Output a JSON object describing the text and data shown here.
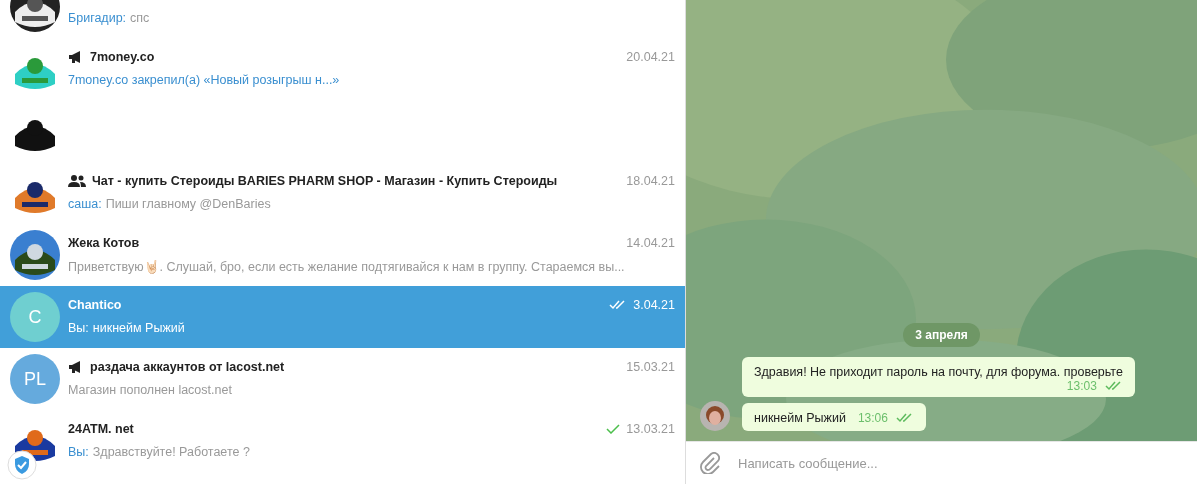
{
  "chats": [
    {
      "kind": "chat",
      "sender": "Бригадир:",
      "preview": "спс",
      "selected": false
    },
    {
      "kind": "channel",
      "name": "7money.co",
      "date": "20.04.21",
      "preview": "7money.co закрепил(а) «Новый розыгрыш н...»",
      "service": true,
      "selected": false
    },
    {
      "kind": "chat",
      "selected": false
    },
    {
      "kind": "group",
      "name": "Чат - купить Стероиды BARIES PHARM SHOP - Магазин - Купить Стероиды",
      "date": "18.04.21",
      "sender": "саша:",
      "preview": "Пиши главному @DenBaries",
      "selected": false
    },
    {
      "kind": "chat",
      "name": "Жека Котов",
      "date": "14.04.21",
      "preview": "Приветствую🤘🏻. Слушай, бро, если есть желание подтягивайся к нам в группу. Стараемся вы...",
      "selected": false
    },
    {
      "kind": "chat",
      "name": "Chantico",
      "date": "3.04.21",
      "sender": "Вы:",
      "preview": "никнейм Рыжий",
      "selected": true,
      "read": true,
      "avatar": {
        "kind": "letters",
        "letters": "C",
        "color": "#6fcfd0"
      }
    },
    {
      "kind": "channel",
      "name": "раздача аккаунтов от lacost.net",
      "date": "15.03.21",
      "preview": "Магазин пополнен lacost.net",
      "selected": false,
      "avatar": {
        "kind": "letters",
        "letters": "PL",
        "color": "#65aadd"
      }
    },
    {
      "kind": "chat",
      "name": "24ATM. net",
      "date": "13.03.21",
      "sender": "Вы:",
      "preview": "Здравствуйте! Работаете ?",
      "selected": false,
      "read": false
    }
  ],
  "conversation": {
    "date_label": "3 апреля",
    "messages": [
      {
        "text": "Здравия! Не приходит пароль на почту, для форума. проверьте",
        "time": "13:03",
        "read": true,
        "avatar": false
      },
      {
        "text": "никнейм Рыжий",
        "time": "13:06",
        "read": true,
        "avatar": true
      }
    ],
    "composer": {
      "placeholder": "Написать сообщение..."
    }
  }
}
